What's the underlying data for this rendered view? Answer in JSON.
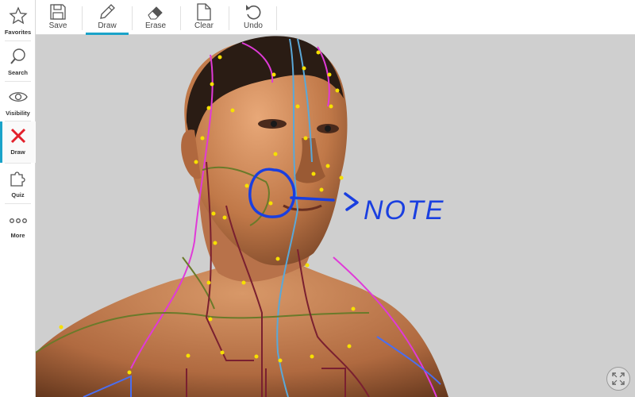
{
  "sidebar": {
    "items": [
      {
        "label": "Favorites",
        "icon": "star-icon"
      },
      {
        "label": "Search",
        "icon": "search-icon"
      },
      {
        "label": "Visibility",
        "icon": "eye-icon"
      },
      {
        "label": "Draw",
        "icon": "x-icon",
        "active": true
      },
      {
        "label": "Quiz",
        "icon": "puzzle-icon"
      },
      {
        "label": "More",
        "icon": "more-icon"
      }
    ]
  },
  "toolbar": {
    "save_label": "Save",
    "draw_label": "Draw",
    "erase_label": "Erase",
    "clear_label": "Clear",
    "undo_label": "Undo"
  },
  "annotation": {
    "text": "NOTE",
    "color": "#1a3fe0"
  },
  "colors": {
    "accent": "#1aa3c9",
    "draw_active": "#e3202b",
    "meridian_magenta": "#e03ad8",
    "meridian_blue": "#4a6ef0",
    "meridian_olive": "#6a7a2a",
    "meridian_maroon": "#7a2030",
    "meridian_lightblue": "#5aa8d8",
    "acupoint": "#f6e000"
  }
}
